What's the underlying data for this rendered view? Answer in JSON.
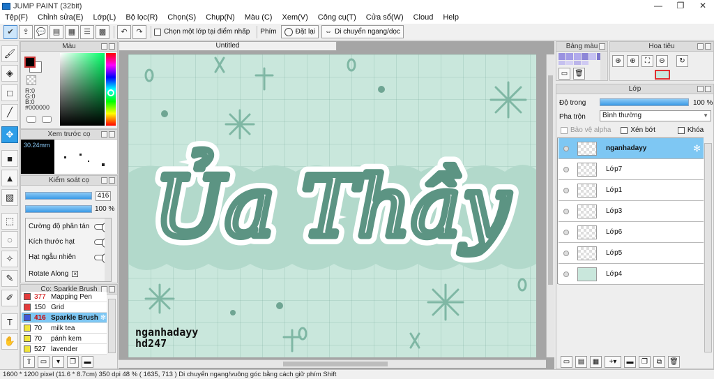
{
  "window": {
    "title": "JUMP PAINT (32bit)",
    "min": "—",
    "restore": "❐",
    "close": "✕"
  },
  "menu": [
    "Tệp(F)",
    "Chỉnh sửa(E)",
    "Lớp(L)",
    "Bộ lọc(R)",
    "Chọn(S)",
    "Chụp(N)",
    "Màu (C)",
    "Xem(V)",
    "Công cụ(T)",
    "Cửa sổ(W)",
    "Cloud",
    "Help"
  ],
  "toolbar": {
    "select_one_layer": "Chọn một lớp tại điểm nhấp",
    "keys_label": "Phím",
    "reset_label": "Đặt lại",
    "move_label": "Di chuyển ngang/dọc"
  },
  "color_panel": {
    "title": "Màu",
    "r": "R:0",
    "g": "G:0",
    "b": "B:0",
    "hex": "#000000",
    "fg": "#000000",
    "bg": "#ffffff"
  },
  "brush_preview": {
    "title": "Xem trước cọ",
    "size": "30.24mm"
  },
  "brush_control": {
    "title": "Kiểm soát cọ",
    "size_value": "416",
    "opacity_value": "100 %",
    "scatter": "Cường độ phân tán",
    "grain_size": "Kích thước hạt",
    "random_grain": "Hạt ngẫu nhiên",
    "rotate_along": "Rotate Along"
  },
  "brush_list": {
    "title": "Cọ: Sparkle Brush",
    "items": [
      {
        "size": "377",
        "name": "Mapping Pen",
        "color": "#e33b3b"
      },
      {
        "size": "150",
        "name": "Grid",
        "color": "#e33b3b"
      },
      {
        "size": "416",
        "name": "Sparkle Brush",
        "color": "#3f57d8"
      },
      {
        "size": "70",
        "name": "milk tea",
        "color": "#f1e53a"
      },
      {
        "size": "70",
        "name": "pánh kem",
        "color": "#f1e53a"
      },
      {
        "size": "527",
        "name": "lavender",
        "color": "#f1e53a"
      }
    ]
  },
  "canvas": {
    "doc_title": "Untitled",
    "art_text": "Ủa Thầy",
    "watermark_line1": "nganhadayy",
    "watermark_line2": "hd247"
  },
  "colorset": {
    "title": "Bảng màu"
  },
  "navigator": {
    "title": "Hoa tiêu"
  },
  "layers": {
    "title": "Lớp",
    "opacity_label": "Độ trong",
    "opacity_value": "100 %",
    "blend_label": "Pha trộn",
    "blend_value": "Bình thường",
    "protect_alpha": "Bảo vệ alpha",
    "clipping": "Xén bớt",
    "lock": "Khóa",
    "items": [
      "nganhadayy",
      "Lớp7",
      "Lớp1",
      "Lớp3",
      "Lớp6",
      "Lớp5",
      "Lớp4"
    ]
  },
  "status": {
    "size": "1600 * 1200 pixel",
    "physical": "(11.6 * 8.7cm)",
    "dpi": "350 dpi",
    "zoom": "48 %",
    "coords": "( 1635, 713 )",
    "hint": "Di chuyển ngang/vuông góc bằng cách giữ phím Shift"
  }
}
